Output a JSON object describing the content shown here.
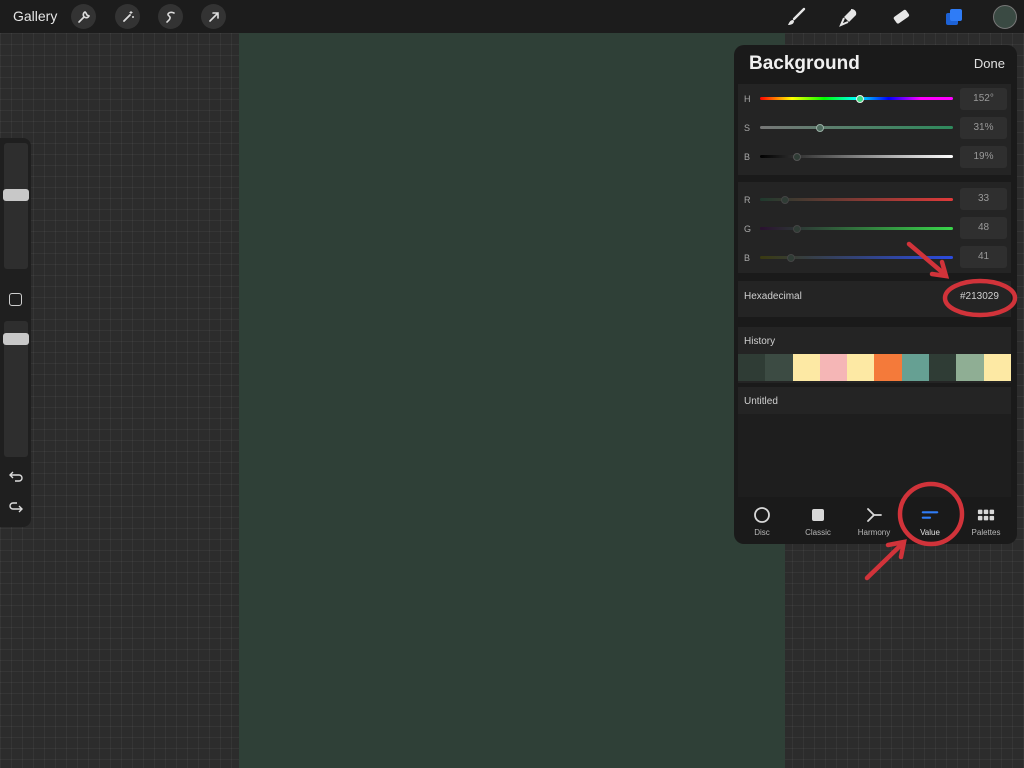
{
  "topbar": {
    "gallery_label": "Gallery",
    "icons": [
      "wrench-icon",
      "magic-wand-icon",
      "selection-icon",
      "transform-arrow-icon"
    ],
    "right_icons": [
      "brush-icon",
      "smudge-icon",
      "eraser-icon",
      "layers-icon"
    ],
    "current_color": "#3a4a43"
  },
  "canvas": {
    "color": "#2f4037"
  },
  "panel": {
    "title": "Background",
    "done_label": "Done",
    "hsb": [
      {
        "label": "H",
        "value": "152°",
        "level": 0.52
      },
      {
        "label": "S",
        "value": "31%",
        "level": 0.31
      },
      {
        "label": "B",
        "value": "19%",
        "level": 0.19
      }
    ],
    "rgb": [
      {
        "label": "R",
        "value": "33",
        "level": 0.13
      },
      {
        "label": "G",
        "value": "48",
        "level": 0.19
      },
      {
        "label": "B",
        "value": "41",
        "level": 0.16
      }
    ],
    "hex_label": "Hexadecimal",
    "hex_value": "#213029",
    "history_label": "History",
    "history": [
      "#2f3c35",
      "#3c4b43",
      "#fde9a4",
      "#f5b6b6",
      "#fde9a4",
      "#f47a3a",
      "#66a093",
      "#2f3c35",
      "#8fae94",
      "#fde9a4"
    ],
    "palette_label": "Untitled",
    "tabs": [
      {
        "label": "Disc",
        "icon": "disc-icon"
      },
      {
        "label": "Classic",
        "icon": "classic-square-icon"
      },
      {
        "label": "Harmony",
        "icon": "harmony-icon"
      },
      {
        "label": "Value",
        "icon": "value-sliders-icon",
        "active": true
      },
      {
        "label": "Palettes",
        "icon": "palettes-grid-icon"
      }
    ],
    "accent_color": "#2f7cf6"
  },
  "sidebar": {
    "brush_size_level": 0.6,
    "opacity_level": 0.9,
    "icons": [
      "modify-square-icon",
      "undo-icon",
      "redo-icon"
    ]
  },
  "annotation_color": "#d1333a"
}
